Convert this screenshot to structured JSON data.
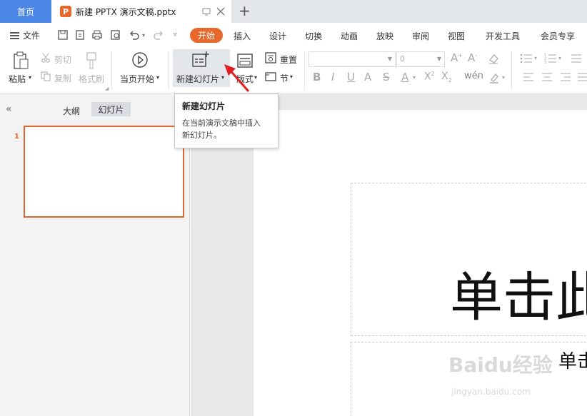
{
  "tabs": {
    "home": "首页",
    "document": "新建 PPTX 演示文稿.pptx",
    "add_symbol": "+"
  },
  "menu": {
    "file": "文件",
    "items": [
      "开始",
      "插入",
      "设计",
      "切换",
      "动画",
      "放映",
      "审阅",
      "视图",
      "开发工具",
      "会员专享"
    ],
    "active": "开始"
  },
  "ribbon": {
    "paste": "粘贴",
    "cut": "剪切",
    "copy": "复制",
    "format_painter": "格式刷",
    "from_current": "当页开始",
    "new_slide": "新建幻灯片",
    "layout": "版式",
    "reset": "重置",
    "section": "节",
    "font_name": "",
    "font_size": "0"
  },
  "sidebar": {
    "outline_tab": "大纲",
    "slides_tab": "幻灯片",
    "slide_number": "1"
  },
  "slide": {
    "title_placeholder": "单击此",
    "subtitle_placeholder": "单击"
  },
  "tooltip": {
    "title": "新建幻灯片",
    "description_line1": "在当前演示文稿中插入",
    "description_line2": "新幻灯片。"
  },
  "watermark": {
    "logo": "Baidu经验",
    "url": "jingyan.baidu.com"
  },
  "colors": {
    "tab_home_bg": "#4d88e6",
    "accent": "#e8682b",
    "arrow_red": "#e02020"
  }
}
